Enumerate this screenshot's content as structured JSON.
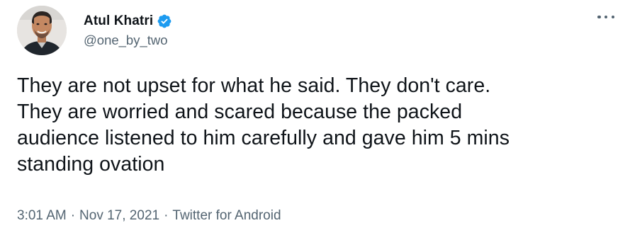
{
  "author": {
    "display_name": "Atul Khatri",
    "handle": "@one_by_two",
    "verified": true,
    "verified_color": "#1d9bf0"
  },
  "menu": {
    "icon": "more-horizontal-icon"
  },
  "tweet": {
    "text_lines": [
      "They are not upset for what he said. They don't care.",
      "They are worried and scared because the packed",
      "audience listened to him carefully and gave him 5 mins",
      "standing ovation"
    ]
  },
  "meta": {
    "time": "3:01 AM",
    "separator": "·",
    "date": "Nov 17, 2021",
    "source": "Twitter for Android"
  },
  "colors": {
    "text_primary": "#0f1419",
    "text_secondary": "#536471",
    "accent": "#1d9bf0"
  }
}
